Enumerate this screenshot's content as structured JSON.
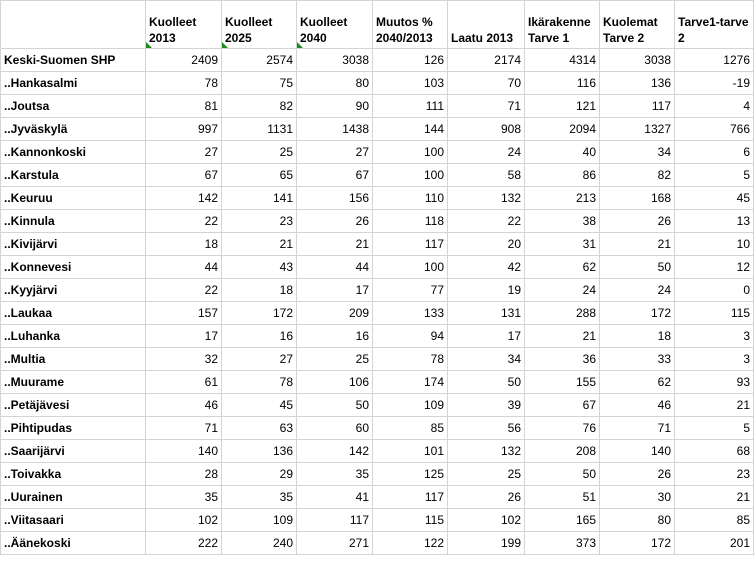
{
  "headers": [
    "",
    "Kuolleet 2013",
    "Kuolleet 2025",
    "Kuolleet 2040",
    "Muutos % 2040/2013",
    "Laatu 2013",
    "Ikärakenne Tarve 1",
    "Kuolemat Tarve 2",
    "Tarve1-tarve 2"
  ],
  "rows": [
    {
      "name": "Keski-Suomen SHP",
      "values": [
        "2409",
        "2574",
        "3038",
        "126",
        "2174",
        "4314",
        "3038",
        "1276"
      ]
    },
    {
      "name": "..Hankasalmi",
      "values": [
        "78",
        "75",
        "80",
        "103",
        "70",
        "116",
        "136",
        "-19"
      ]
    },
    {
      "name": "..Joutsa",
      "values": [
        "81",
        "82",
        "90",
        "111",
        "71",
        "121",
        "117",
        "4"
      ]
    },
    {
      "name": "..Jyväskylä",
      "values": [
        "997",
        "1131",
        "1438",
        "144",
        "908",
        "2094",
        "1327",
        "766"
      ]
    },
    {
      "name": "..Kannonkoski",
      "values": [
        "27",
        "25",
        "27",
        "100",
        "24",
        "40",
        "34",
        "6"
      ]
    },
    {
      "name": "..Karstula",
      "values": [
        "67",
        "65",
        "67",
        "100",
        "58",
        "86",
        "82",
        "5"
      ]
    },
    {
      "name": "..Keuruu",
      "values": [
        "142",
        "141",
        "156",
        "110",
        "132",
        "213",
        "168",
        "45"
      ]
    },
    {
      "name": "..Kinnula",
      "values": [
        "22",
        "23",
        "26",
        "118",
        "22",
        "38",
        "26",
        "13"
      ]
    },
    {
      "name": "..Kivijärvi",
      "values": [
        "18",
        "21",
        "21",
        "117",
        "20",
        "31",
        "21",
        "10"
      ]
    },
    {
      "name": "..Konnevesi",
      "values": [
        "44",
        "43",
        "44",
        "100",
        "42",
        "62",
        "50",
        "12"
      ]
    },
    {
      "name": "..Kyyjärvi",
      "values": [
        "22",
        "18",
        "17",
        "77",
        "19",
        "24",
        "24",
        "0"
      ]
    },
    {
      "name": "..Laukaa",
      "values": [
        "157",
        "172",
        "209",
        "133",
        "131",
        "288",
        "172",
        "115"
      ]
    },
    {
      "name": "..Luhanka",
      "values": [
        "17",
        "16",
        "16",
        "94",
        "17",
        "21",
        "18",
        "3"
      ]
    },
    {
      "name": "..Multia",
      "values": [
        "32",
        "27",
        "25",
        "78",
        "34",
        "36",
        "33",
        "3"
      ]
    },
    {
      "name": "..Muurame",
      "values": [
        "61",
        "78",
        "106",
        "174",
        "50",
        "155",
        "62",
        "93"
      ]
    },
    {
      "name": "..Petäjävesi",
      "values": [
        "46",
        "45",
        "50",
        "109",
        "39",
        "67",
        "46",
        "21"
      ]
    },
    {
      "name": "..Pihtipudas",
      "values": [
        "71",
        "63",
        "60",
        "85",
        "56",
        "76",
        "71",
        "5"
      ]
    },
    {
      "name": "..Saarijärvi",
      "values": [
        "140",
        "136",
        "142",
        "101",
        "132",
        "208",
        "140",
        "68"
      ]
    },
    {
      "name": "..Toivakka",
      "values": [
        "28",
        "29",
        "35",
        "125",
        "25",
        "50",
        "26",
        "23"
      ]
    },
    {
      "name": "..Uurainen",
      "values": [
        "35",
        "35",
        "41",
        "117",
        "26",
        "51",
        "30",
        "21"
      ]
    },
    {
      "name": "..Viitasaari",
      "values": [
        "102",
        "109",
        "117",
        "115",
        "102",
        "165",
        "80",
        "85"
      ]
    },
    {
      "name": "..Äänekoski",
      "values": [
        "222",
        "240",
        "271",
        "122",
        "199",
        "373",
        "172",
        "201"
      ]
    }
  ],
  "indicator_color": "#1e8a1e"
}
